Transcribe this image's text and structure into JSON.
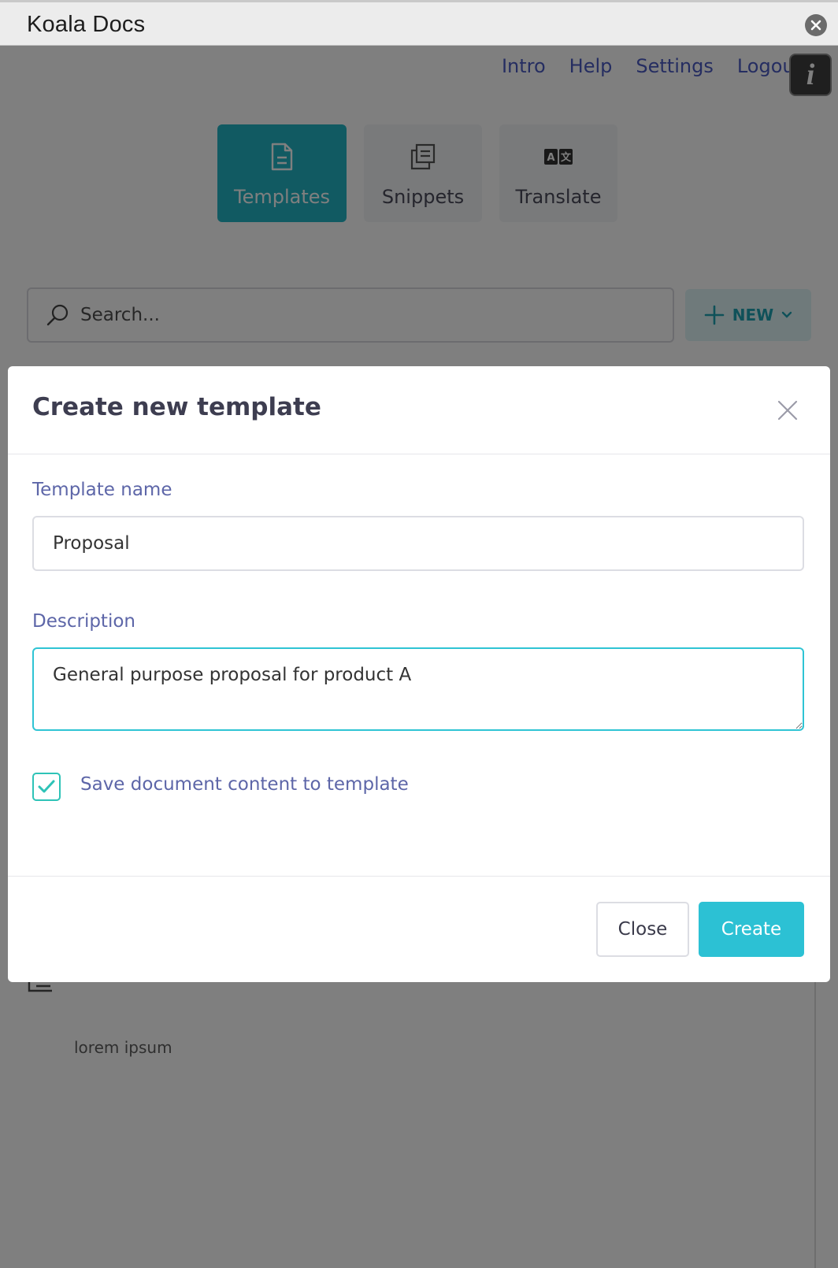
{
  "window": {
    "title": "Koala Docs"
  },
  "topnav": {
    "items": [
      "Intro",
      "Help",
      "Settings",
      "Logout"
    ],
    "info_label": "i"
  },
  "tabs": [
    {
      "label": "Templates",
      "icon": "document-icon",
      "active": true
    },
    {
      "label": "Snippets",
      "icon": "copy-icon",
      "active": false
    },
    {
      "label": "Translate",
      "icon": "translate-icon",
      "active": false
    }
  ],
  "search": {
    "placeholder": "Search..."
  },
  "new_button": {
    "label": "NEW"
  },
  "list": {
    "items": [
      {
        "description": "lorem ipsum"
      }
    ]
  },
  "modal": {
    "title": "Create new template",
    "name_label": "Template name",
    "name_value": "Proposal",
    "description_label": "Description",
    "description_value": "General purpose proposal for product A",
    "checkbox_label": "Save document content to template",
    "checkbox_checked": true,
    "close_label": "Close",
    "create_label": "Create"
  },
  "colors": {
    "accent": "#2cc1d4",
    "active_tab": "#22b5c5",
    "link": "#4b5bc2",
    "label": "#5d66a8",
    "checkbox": "#2ec3b7"
  }
}
